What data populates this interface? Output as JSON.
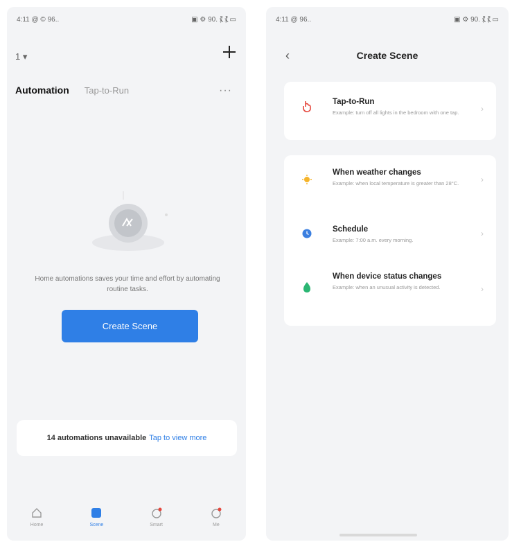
{
  "left_screen": {
    "status_left": "4:11 @ © 96..",
    "status_right": "▣ ⚙ 90. ⳩ ⳩ ▭",
    "home_selector": "1 ▾",
    "tabs": [
      {
        "label": "Automation",
        "active": true
      },
      {
        "label": "Tap-to-Run",
        "active": false
      }
    ],
    "more": "···",
    "empty_message": "Home automations saves your time and effort by automating routine tasks.",
    "create_button": "Create Scene",
    "unavailable_text": "14 automations unavailable",
    "unavailable_link": "Tap to view more",
    "bottom_nav": [
      {
        "label": "Home",
        "icon": "home-icon",
        "active": false
      },
      {
        "label": "Scene",
        "icon": "scene-icon",
        "active": true
      },
      {
        "label": "Smart",
        "icon": "smart-icon",
        "active": false
      },
      {
        "label": "Me",
        "icon": "profile-icon",
        "active": false
      }
    ]
  },
  "right_screen": {
    "status_left": "4:11 @ 96..",
    "status_right": "▣ ⚙ 90. ⳩ ⳩ ▭",
    "back": "‹",
    "title": "Create Scene",
    "tap_option": {
      "title": "Tap-to-Run",
      "desc": "Example: turn off all lights in the bedroom with one tap."
    },
    "automation_options": [
      {
        "title": "When weather changes",
        "desc": "Example: when local temperature is greater than 28°C.",
        "icon": "weather-icon"
      },
      {
        "title": "Schedule",
        "desc": "Example: 7:00 a.m. every morning.",
        "icon": "schedule-icon"
      },
      {
        "title": "When device status changes",
        "desc": "Example: when an unusual activity is detected.",
        "icon": "device-status-icon"
      }
    ]
  },
  "colors": {
    "accent": "#2f7fe6",
    "tap_icon": "#e5463c",
    "weather_icon": "#f5b42a",
    "schedule_icon": "#3b7fe0",
    "device_icon": "#2bb673"
  }
}
